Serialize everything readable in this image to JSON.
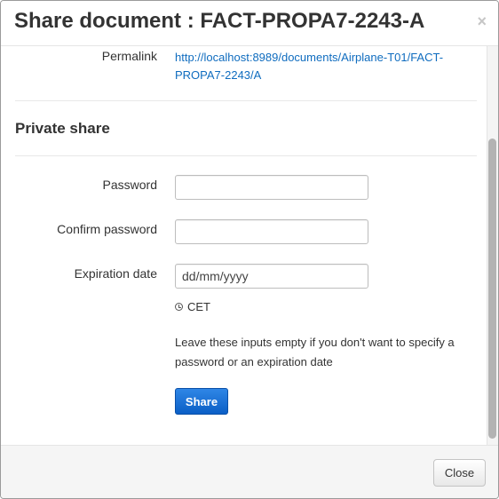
{
  "dialog": {
    "title": "Share document : FACT-PROPA7-2243-A",
    "close_symbol": "×"
  },
  "permalink": {
    "label": "Permalink",
    "url": "http://localhost:8989/documents/Airplane-T01/FACT-PROPA7-2243/A"
  },
  "private_share": {
    "heading": "Private share",
    "password_label": "Password",
    "password_value": "",
    "confirm_label": "Confirm password",
    "confirm_value": "",
    "expiration_label": "Expiration date",
    "expiration_placeholder": "dd/mm/yyyy",
    "timezone": "CET",
    "help_text": "Leave these inputs empty if you don't want to specify a password or an expiration date",
    "share_button": "Share"
  },
  "footer": {
    "close_button": "Close"
  },
  "colors": {
    "link": "#0f6cbf",
    "primary_button": "#0b5fc6",
    "footer_bg": "#f5f5f5"
  }
}
